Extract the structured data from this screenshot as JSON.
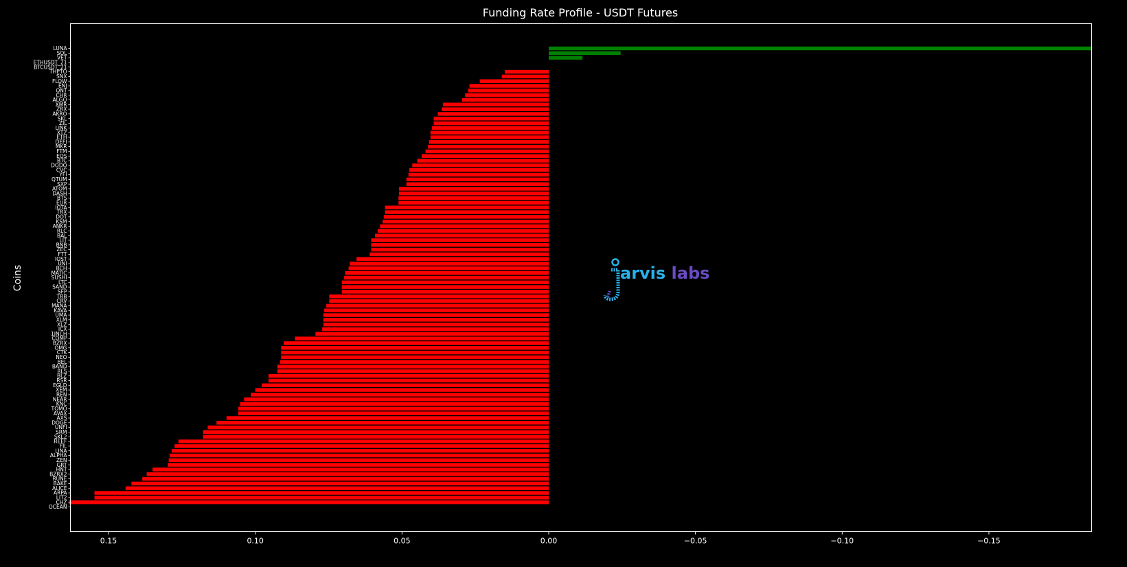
{
  "chart_data": {
    "type": "bar",
    "orientation": "horizontal",
    "title": "Funding Rate Profile - USDT Futures",
    "ylabel": "Coins",
    "xlabel": "",
    "xlim": [
      0.163,
      -0.185
    ],
    "x_ticks": [
      0.15,
      0.1,
      0.05,
      0.0,
      -0.05,
      -0.1,
      -0.15
    ],
    "x_tick_labels": [
      "0.15",
      "0.10",
      "0.05",
      "0.00",
      "−0.05",
      "−0.10",
      "−0.15"
    ],
    "grid": false,
    "colors": {
      "positive": "#ff0000",
      "negative": "#008000",
      "background": "#000000",
      "foreground": "#ffffff"
    },
    "categories": [
      "LUNA",
      "SOL",
      "VET",
      "ETHUSDT_21",
      "BTCUSDT_21",
      "THETO",
      "SNX",
      "FLOW",
      "ENJ",
      "ONT",
      "CHR",
      "ALGO",
      "XMR",
      "ZRX",
      "AKRO",
      "SKL",
      "ZIL",
      "LINK",
      "XTZ",
      "ETH",
      "DEFI",
      "MKR",
      "FTM",
      "EOS",
      "BTC",
      "DODO",
      "CVC",
      "YFI",
      "QTUM",
      "SXP",
      "ATOM",
      "DASH",
      "BTS",
      "EUR",
      "IOTA",
      "TRX",
      "DOT",
      "KSM",
      "ANKR",
      "RLC",
      "BAL",
      "LIT",
      "BNB",
      "ZEC",
      "FTT",
      "IOST",
      "UNI",
      "BCH",
      "MATIC",
      "SUSHI",
      "LTC",
      "SAND",
      "SFP",
      "TRB",
      "CRV",
      "MANA",
      "KAVA",
      "UMA",
      "XLM",
      "XLZ",
      "ICX",
      "1INCH",
      "COMP",
      "BZRX",
      "OMG",
      "CTK",
      "NEO",
      "BEL",
      "BAND",
      "RLS",
      "BLZ",
      "RSR",
      "EGLD",
      "XEM",
      "REN",
      "NEAR",
      "KNC",
      "TOMO",
      "AVAX",
      "AXS",
      "DOGE",
      "UNFI",
      "SRM",
      "SKL2",
      "REEF",
      "FIL",
      "LINA",
      "ALPHA",
      "ZEN",
      "GRT",
      "HNT",
      "BZRX2",
      "RUNE",
      "BAKE",
      "ALICE",
      "ARPA",
      "LIT2",
      "CHZ",
      "OCEAN"
    ],
    "values": [
      -0.185,
      -0.0245,
      -0.0115,
      0,
      0,
      0.015,
      0.016,
      0.0235,
      0.027,
      0.0275,
      0.0285,
      0.0295,
      0.036,
      0.0365,
      0.0378,
      0.0392,
      0.0392,
      0.0398,
      0.0403,
      0.0403,
      0.0408,
      0.0412,
      0.042,
      0.0433,
      0.0448,
      0.0465,
      0.0475,
      0.0478,
      0.0485,
      0.0485,
      0.051,
      0.051,
      0.0512,
      0.0512,
      0.0558,
      0.0558,
      0.0562,
      0.0566,
      0.0575,
      0.0583,
      0.0592,
      0.0605,
      0.0605,
      0.0605,
      0.061,
      0.0655,
      0.0678,
      0.0682,
      0.0694,
      0.0698,
      0.0705,
      0.0705,
      0.0705,
      0.0748,
      0.0748,
      0.0758,
      0.0765,
      0.0768,
      0.0768,
      0.0768,
      0.0772,
      0.0795,
      0.0865,
      0.0903,
      0.0912,
      0.0912,
      0.0912,
      0.0915,
      0.0925,
      0.0925,
      0.0955,
      0.0955,
      0.0978,
      0.1,
      0.1015,
      0.1038,
      0.1052,
      0.1058,
      0.1058,
      0.1098,
      0.1132,
      0.1162,
      0.1178,
      0.1178,
      0.1262,
      0.1275,
      0.1285,
      0.1292,
      0.1295,
      0.1298,
      0.135,
      0.137,
      0.1385,
      0.1422,
      0.1442,
      0.1548,
      0.1548,
      0.1635
    ]
  },
  "watermark": {
    "text": "arvis labs",
    "letter_j": "j"
  }
}
